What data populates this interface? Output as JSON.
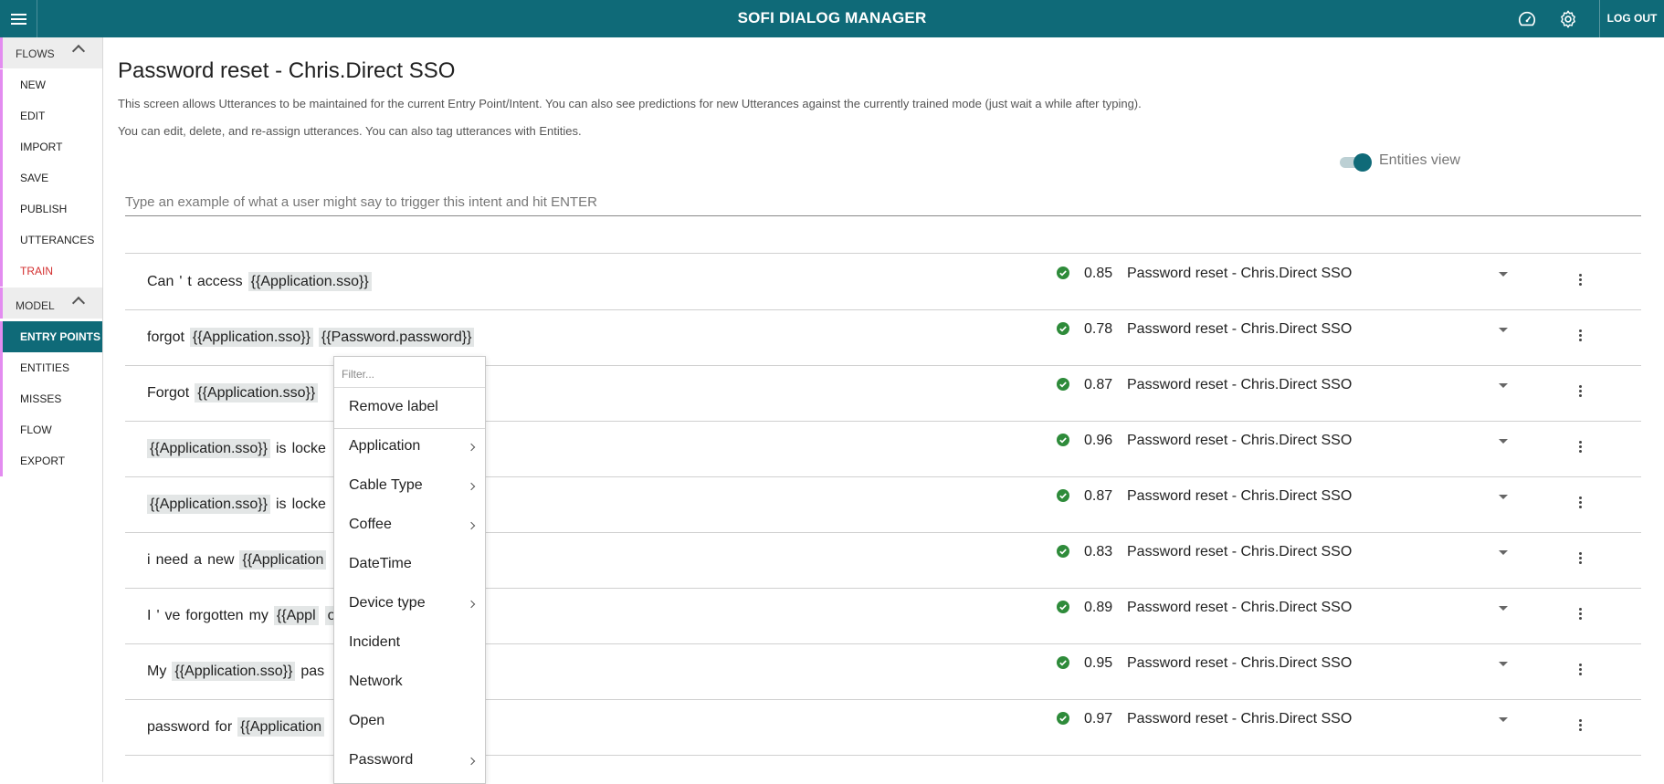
{
  "header": {
    "app_title": "SOFI DIALOG MANAGER",
    "logout_label": "LOG OUT",
    "icons": [
      "menu-icon",
      "dashboard-icon",
      "settings-gear-icon"
    ]
  },
  "sidebar": {
    "flows_label": "FLOWS",
    "flows_items": [
      "NEW",
      "EDIT",
      "IMPORT",
      "SAVE",
      "PUBLISH",
      "UTTERANCES",
      "TRAIN"
    ],
    "model_label": "MODEL",
    "model_items": [
      "ENTRY POINTS",
      "ENTITIES",
      "MISSES",
      "FLOW",
      "EXPORT"
    ],
    "active_item": "ENTRY POINTS",
    "accent_color": "#e38cf0"
  },
  "main": {
    "title": "Password reset - Chris.Direct SSO",
    "description_1": "This screen allows Utterances to be maintained for the current Entry Point/Intent. You can also see predictions for new Utterances against the currently trained mode (just wait a while after typing).",
    "description_2": "You can edit, delete, and re-assign utterances. You can also tag utterances with Entities.",
    "entities_view_label": "Entities view",
    "entities_view_on": true,
    "input_placeholder": "Type an example of what a user might say to trigger this intent and hit ENTER",
    "input_value": ""
  },
  "utterances": [
    {
      "segments": [
        {
          "t": "Can"
        },
        {
          "t": "'"
        },
        {
          "t": "t"
        },
        {
          "t": "access"
        },
        {
          "t": "{{Application.sso}}",
          "e": true
        }
      ],
      "score": "0.85",
      "intent": "Password reset - Chris.Direct SSO"
    },
    {
      "segments": [
        {
          "t": "forgot"
        },
        {
          "t": "{{Application.sso}}",
          "e": true
        },
        {
          "t": "{{Password.password}}",
          "e": true
        }
      ],
      "score": "0.78",
      "intent": "Password reset - Chris.Direct SSO"
    },
    {
      "segments": [
        {
          "t": "Forgot"
        },
        {
          "t": "{{Application.sso}}",
          "e": true
        }
      ],
      "score": "0.87",
      "intent": "Password reset - Chris.Direct SSO"
    },
    {
      "segments": [
        {
          "t": "{{Application.sso}}",
          "e": true
        },
        {
          "t": "is"
        },
        {
          "t": "locke"
        }
      ],
      "score": "0.96",
      "intent": "Password reset - Chris.Direct SSO"
    },
    {
      "segments": [
        {
          "t": "{{Application.sso}}",
          "e": true
        },
        {
          "t": "is"
        },
        {
          "t": "locke"
        }
      ],
      "score": "0.87",
      "intent": "Password reset - Chris.Direct SSO"
    },
    {
      "segments": [
        {
          "t": "i"
        },
        {
          "t": "need"
        },
        {
          "t": "a"
        },
        {
          "t": "new"
        },
        {
          "t": "{{Application",
          "e": true
        }
      ],
      "score": "0.83",
      "intent": "Password reset - Chris.Direct SSO"
    },
    {
      "segments": [
        {
          "t": "I"
        },
        {
          "t": "'"
        },
        {
          "t": "ve"
        },
        {
          "t": "forgotten"
        },
        {
          "t": "my"
        },
        {
          "t": "{{Appl",
          "e": true
        },
        {
          "t": "ord.password}}",
          "e": true,
          "gap": true
        }
      ],
      "score": "0.89",
      "intent": "Password reset - Chris.Direct SSO"
    },
    {
      "segments": [
        {
          "t": "My"
        },
        {
          "t": "{{Application.sso}}",
          "e": true
        },
        {
          "t": "pas"
        }
      ],
      "score": "0.95",
      "intent": "Password reset - Chris.Direct SSO"
    },
    {
      "segments": [
        {
          "t": "password"
        },
        {
          "t": "for"
        },
        {
          "t": "{{Application",
          "e": true
        }
      ],
      "score": "0.97",
      "intent": "Password reset - Chris.Direct SSO"
    }
  ],
  "context_menu": {
    "filter_placeholder": "Filter...",
    "remove_label": "Remove label",
    "items": [
      {
        "label": "Application",
        "submenu": true
      },
      {
        "label": "Cable Type",
        "submenu": true
      },
      {
        "label": "Coffee",
        "submenu": true
      },
      {
        "label": "DateTime",
        "submenu": false
      },
      {
        "label": "Device type",
        "submenu": true
      },
      {
        "label": "Incident",
        "submenu": false
      },
      {
        "label": "Network",
        "submenu": false
      },
      {
        "label": "Open",
        "submenu": false
      },
      {
        "label": "Password",
        "submenu": true
      }
    ]
  },
  "colors": {
    "primary": "#0f6a78",
    "success": "#2e8b3a",
    "train_red": "#d32f2f"
  }
}
